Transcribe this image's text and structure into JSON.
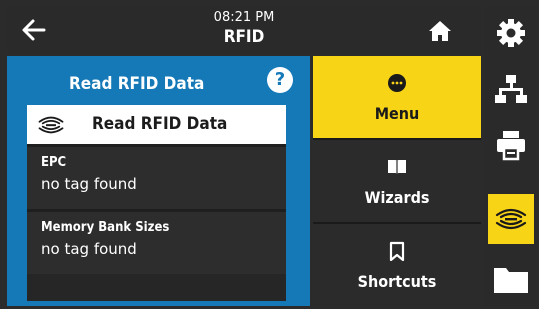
{
  "header": {
    "time": "08:21 PM",
    "title": "RFID"
  },
  "panel": {
    "title": "Read RFID Data",
    "help_symbol": "?",
    "card_label": "Read RFID Data",
    "rows": [
      {
        "key": "EPC",
        "value": "no tag found"
      },
      {
        "key": "Memory Bank Sizes",
        "value": "no tag found"
      }
    ]
  },
  "menu": {
    "items": [
      {
        "label": "Menu",
        "icon": "menu-dots-icon",
        "active": true
      },
      {
        "label": "Wizards",
        "icon": "book-icon",
        "active": false
      },
      {
        "label": "Shortcuts",
        "icon": "bookmark-icon",
        "active": false
      }
    ]
  },
  "sidebar": {
    "items": [
      {
        "icon": "gear-icon",
        "active": false
      },
      {
        "icon": "network-icon",
        "active": false
      },
      {
        "icon": "printer-icon",
        "active": false
      },
      {
        "icon": "rfid-icon",
        "active": true
      },
      {
        "icon": "folder-icon",
        "active": false
      }
    ]
  },
  "colors": {
    "accent": "#f8d417",
    "panel_blue": "#1579b8",
    "dark": "#2b2b2b"
  }
}
